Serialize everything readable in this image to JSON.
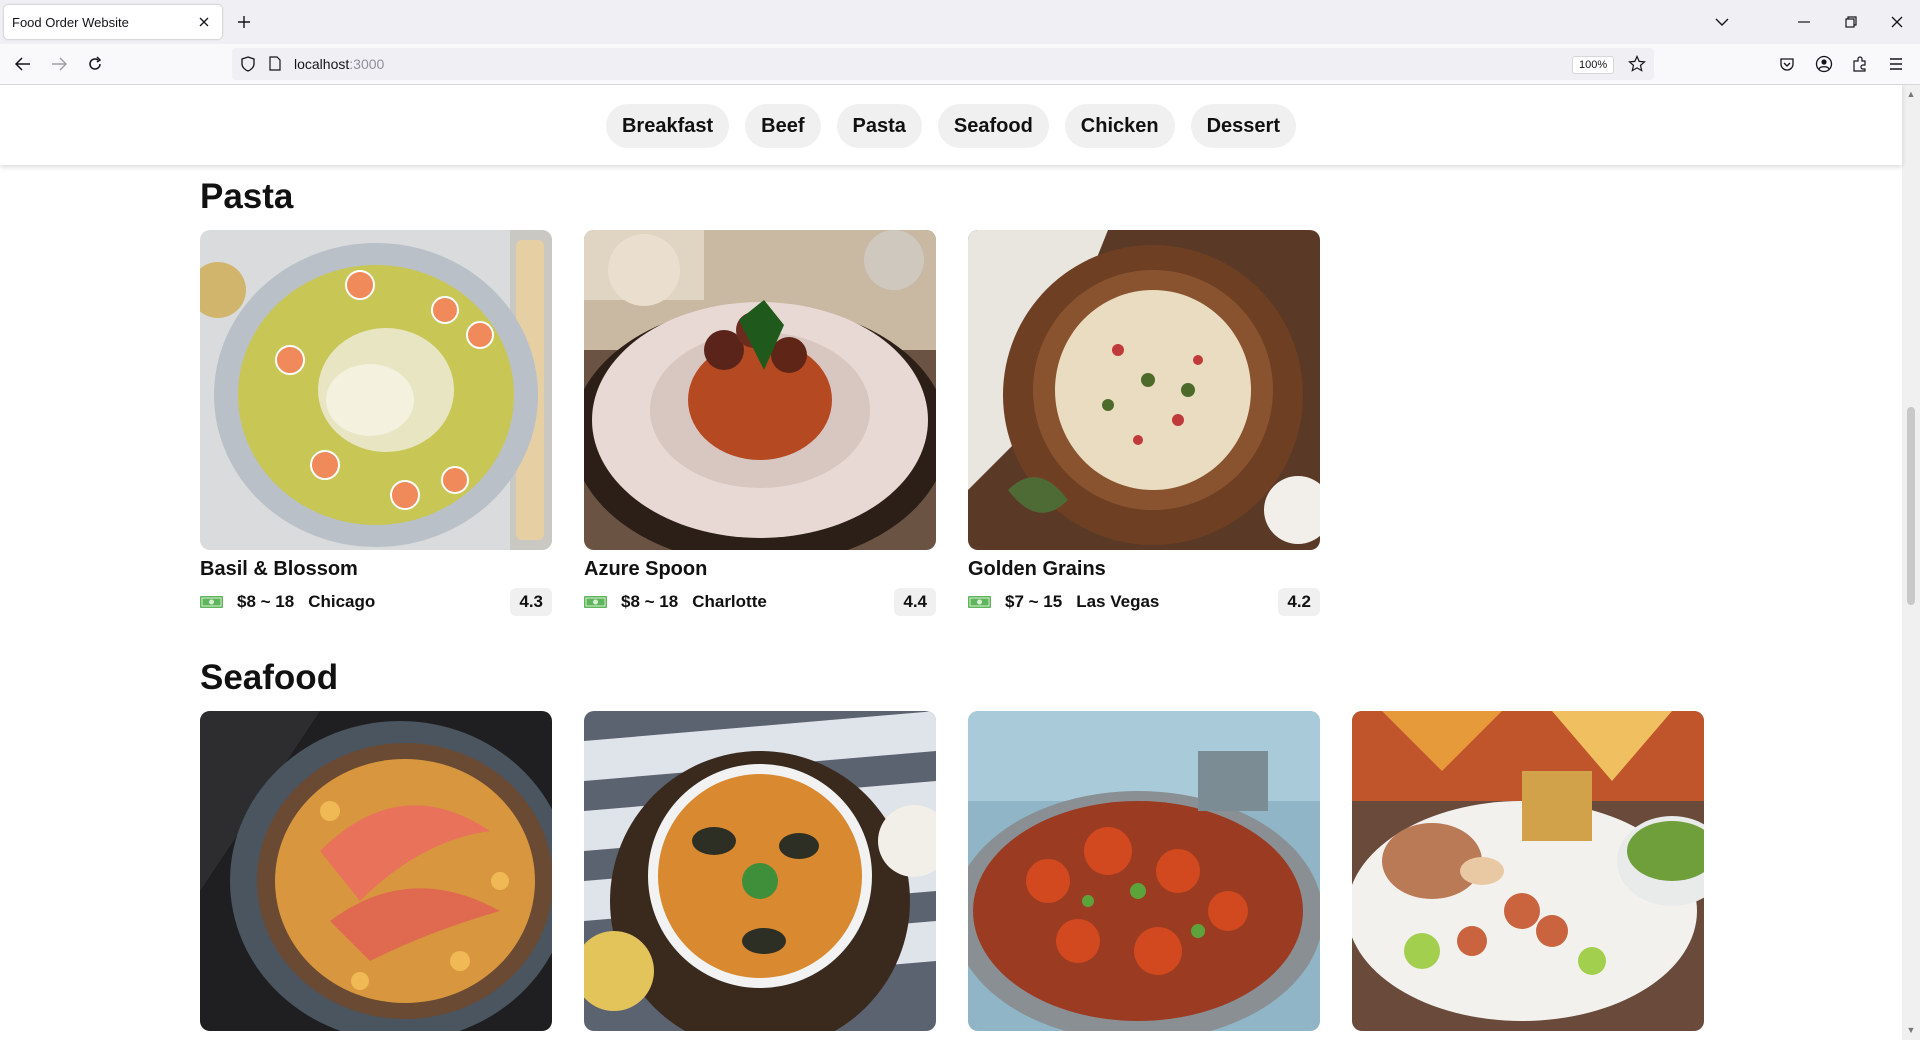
{
  "browser": {
    "tab_title": "Food Order Website",
    "url_host": "localhost",
    "url_port": ":3000",
    "zoom": "100%"
  },
  "categories": [
    "Breakfast",
    "Beef",
    "Pasta",
    "Seafood",
    "Chicken",
    "Dessert"
  ],
  "sections": [
    {
      "title": "Pasta",
      "cards": [
        {
          "name": "Basil & Blossom",
          "price": "$8 ~ 18",
          "city": "Chicago",
          "rating": "4.3"
        },
        {
          "name": "Azure Spoon",
          "price": "$8 ~ 18",
          "city": "Charlotte",
          "rating": "4.4"
        },
        {
          "name": "Golden Grains",
          "price": "$7 ~ 15",
          "city": "Las Vegas",
          "rating": "4.2"
        }
      ]
    },
    {
      "title": "Seafood",
      "cards": [
        {
          "name": "",
          "price": "",
          "city": "",
          "rating": ""
        },
        {
          "name": "",
          "price": "",
          "city": "",
          "rating": ""
        },
        {
          "name": "",
          "price": "",
          "city": "",
          "rating": ""
        },
        {
          "name": "",
          "price": "",
          "city": "",
          "rating": ""
        }
      ]
    }
  ],
  "colors": {
    "money_icon": "#5fb55a",
    "pill_bg": "#f0f0f0"
  }
}
